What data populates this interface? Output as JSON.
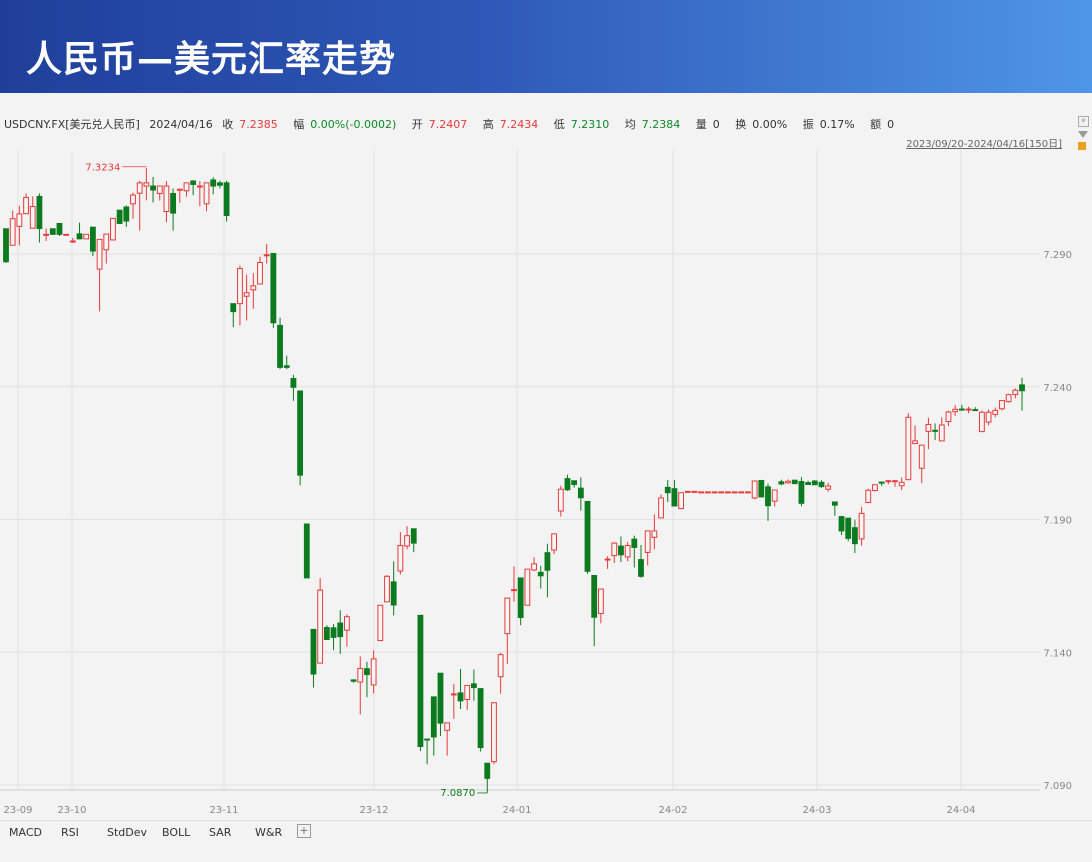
{
  "header": {
    "title": "人民币—美元汇率走势"
  },
  "quote": {
    "symbol": "USDCNY.FX[美元兑人民币]",
    "date": "2024/04/16",
    "close_label": "收",
    "close": "7.2385",
    "change_label": "幅",
    "change": "0.00%(-0.0002)",
    "open_label": "开",
    "open": "7.2407",
    "high_label": "高",
    "high": "7.2434",
    "low_label": "低",
    "low": "7.2310",
    "avg_label": "均",
    "avg": "7.2384",
    "volume_label": "量",
    "volume": "0",
    "turnover_label": "换",
    "turnover": "0.00%",
    "amplitude_label": "振",
    "amplitude": "0.17%",
    "amount_label": "额",
    "amount": "0"
  },
  "range_label": "2023/09/20-2024/04/16[150日]",
  "indicators": [
    "MACD",
    "RSI",
    "StdDev",
    "BOLL",
    "SAR",
    "W&R"
  ],
  "colors": {
    "up": "#e83a3a",
    "down": "#0c7a1e",
    "grid": "#e2e2e2",
    "axis_text": "#888888"
  },
  "chart_data": {
    "type": "candlestick",
    "ylim": [
      7.085,
      7.335
    ],
    "yticks": [
      "7.290",
      "7.240",
      "7.190",
      "7.140",
      "7.090"
    ],
    "xticks": [
      "23-09",
      "23-10",
      "23-11",
      "23-12",
      "24-01",
      "24-02",
      "24-03",
      "24-04"
    ],
    "max_label": "7.3234",
    "min_label": "7.0870",
    "ohlc": [
      [
        7.2995,
        7.2995,
        7.2866,
        7.2871
      ],
      [
        7.2933,
        7.3064,
        7.2933,
        7.3033
      ],
      [
        7.3004,
        7.3081,
        7.2933,
        7.3051
      ],
      [
        7.3052,
        7.3128,
        7.3052,
        7.3113
      ],
      [
        7.2997,
        7.3117,
        7.2997,
        7.3079
      ],
      [
        7.3117,
        7.3128,
        7.2943,
        7.2996
      ],
      [
        7.2974,
        7.2996,
        7.2949,
        7.2974
      ],
      [
        7.2995,
        7.2995,
        7.2974,
        7.2974
      ],
      [
        7.3015,
        7.3015,
        7.2968,
        7.2974
      ],
      [
        7.2974,
        7.2974,
        7.2974,
        7.2974
      ],
      [
        7.2949,
        7.2961,
        7.2942,
        7.2949
      ],
      [
        7.2976,
        7.3018,
        7.2957,
        7.2957
      ],
      [
        7.2957,
        7.2974,
        7.2957,
        7.2974
      ],
      [
        7.3001,
        7.3001,
        7.2892,
        7.2911
      ],
      [
        7.2843,
        7.2935,
        7.2684,
        7.2955
      ],
      [
        7.2916,
        7.2975,
        7.2864,
        7.2975
      ],
      [
        7.2953,
        7.3034,
        7.2953,
        7.3034
      ],
      [
        7.3065,
        7.3065,
        7.3015,
        7.3015
      ],
      [
        7.3077,
        7.3083,
        7.3002,
        7.3024
      ],
      [
        7.3089,
        7.3131,
        7.3033,
        7.3122
      ],
      [
        7.3129,
        7.3176,
        7.2988,
        7.3168
      ],
      [
        7.3156,
        7.3225,
        7.3102,
        7.3168
      ],
      [
        7.3156,
        7.319,
        7.3094,
        7.3141
      ],
      [
        7.3128,
        7.3156,
        7.3101,
        7.3156
      ],
      [
        7.306,
        7.3175,
        7.302,
        7.3156
      ],
      [
        7.3128,
        7.3147,
        7.2988,
        7.3054
      ],
      [
        7.3143,
        7.3146,
        7.3093,
        7.3144
      ],
      [
        7.3138,
        7.3168,
        7.3116,
        7.3168
      ],
      [
        7.3175,
        7.3178,
        7.3122,
        7.3162
      ],
      [
        7.3156,
        7.3175,
        7.308,
        7.3156
      ],
      [
        7.3089,
        7.3169,
        7.3061,
        7.3168
      ],
      [
        7.3179,
        7.3189,
        7.3125,
        7.3156
      ],
      [
        7.3168,
        7.3176,
        7.3147,
        7.3159
      ],
      [
        7.3168,
        7.3176,
        7.3022,
        7.3045
      ],
      [
        7.2713,
        7.2713,
        7.2624,
        7.2683
      ],
      [
        7.2713,
        7.2857,
        7.2631,
        7.2845
      ],
      [
        7.2741,
        7.2822,
        7.265,
        7.2754
      ],
      [
        7.2765,
        7.2828,
        7.2694,
        7.278
      ],
      [
        7.2787,
        7.289,
        7.2787,
        7.2868
      ],
      [
        7.2897,
        7.2938,
        7.2864,
        7.2897
      ],
      [
        7.2902,
        7.2901,
        7.2622,
        7.2641
      ],
      [
        7.2631,
        7.266,
        7.2466,
        7.2473
      ],
      [
        7.2479,
        7.2517,
        7.2466,
        7.2473
      ],
      [
        7.2431,
        7.2445,
        7.2347,
        7.2398
      ],
      [
        7.2384,
        7.2384,
        7.2029,
        7.2067
      ],
      [
        7.1883,
        7.1883,
        7.168,
        7.168
      ],
      [
        7.1486,
        7.1486,
        7.1267,
        7.1318
      ],
      [
        7.1359,
        7.168,
        7.1359,
        7.1634
      ],
      [
        7.1493,
        7.1502,
        7.1449,
        7.1448
      ],
      [
        7.1492,
        7.1506,
        7.1408,
        7.1456
      ],
      [
        7.151,
        7.1558,
        7.1394,
        7.1459
      ],
      [
        7.1483,
        7.1543,
        7.1421,
        7.1534
      ],
      [
        7.1296,
        7.1296,
        7.1285,
        7.1291
      ],
      [
        7.1288,
        7.1385,
        7.1166,
        7.1339
      ],
      [
        7.1338,
        7.1364,
        7.1231,
        7.1316
      ],
      [
        7.1277,
        7.1407,
        7.1245,
        7.1375
      ],
      [
        7.1444,
        7.1575,
        7.1444,
        7.1577
      ],
      [
        7.159,
        7.1691,
        7.159,
        7.1686
      ],
      [
        7.1665,
        7.1742,
        7.1539,
        7.1578
      ],
      [
        7.1706,
        7.1853,
        7.1693,
        7.1802
      ],
      [
        7.18,
        7.1875,
        7.1788,
        7.1839
      ],
      [
        7.1865,
        7.1862,
        7.1777,
        7.1811
      ],
      [
        7.1539,
        7.1539,
        7.1028,
        7.1045
      ],
      [
        7.1073,
        7.1073,
        7.0978,
        7.107
      ],
      [
        7.1232,
        7.1232,
        7.1011,
        7.1081
      ],
      [
        7.1321,
        7.1321,
        7.1084,
        7.1133
      ],
      [
        7.1106,
        7.1106,
        7.1011,
        7.1134
      ],
      [
        7.1243,
        7.1281,
        7.1149,
        7.1243
      ],
      [
        7.1247,
        7.1337,
        7.1186,
        7.1217
      ],
      [
        7.1222,
        7.1275,
        7.1183,
        7.1275
      ],
      [
        7.1281,
        7.1335,
        7.1218,
        7.1267
      ],
      [
        7.1263,
        7.1263,
        7.1026,
        7.1041
      ],
      [
        7.0982,
        7.0982,
        7.087,
        7.0925
      ],
      [
        7.0988,
        7.121,
        7.0978,
        7.121
      ],
      [
        7.1308,
        7.1398,
        7.1244,
        7.1391
      ],
      [
        7.147,
        7.1604,
        7.1356,
        7.1604
      ],
      [
        7.1636,
        7.1723,
        7.1591,
        7.1636
      ],
      [
        7.168,
        7.168,
        7.1502,
        7.1531
      ],
      [
        7.1577,
        7.1713,
        7.1577,
        7.1713
      ],
      [
        7.171,
        7.1758,
        7.1705,
        7.1733
      ],
      [
        7.1701,
        7.1726,
        7.164,
        7.1688
      ],
      [
        7.1775,
        7.1809,
        7.1607,
        7.1709
      ],
      [
        7.1785,
        7.1846,
        7.1769,
        7.1846
      ],
      [
        7.1932,
        7.2027,
        7.1911,
        7.2014
      ],
      [
        7.2054,
        7.2069,
        7.2008,
        7.2012
      ],
      [
        7.2046,
        7.2046,
        7.202,
        7.2032
      ],
      [
        7.2018,
        7.2059,
        7.1933,
        7.1982
      ],
      [
        7.1968,
        7.1968,
        7.1695,
        7.1705
      ],
      [
        7.1689,
        7.1689,
        7.1423,
        7.1532
      ],
      [
        7.1546,
        7.1638,
        7.1509,
        7.1638
      ],
      [
        7.1751,
        7.1762,
        7.1714,
        7.1751
      ],
      [
        7.1764,
        7.1815,
        7.1736,
        7.1811
      ],
      [
        7.18,
        7.1836,
        7.174,
        7.1767
      ],
      [
        7.1759,
        7.1815,
        7.1743,
        7.1802
      ],
      [
        7.1826,
        7.1839,
        7.1719,
        7.1795
      ],
      [
        7.1749,
        7.1804,
        7.168,
        7.1686
      ],
      [
        7.1776,
        7.1858,
        7.1727,
        7.1857
      ],
      [
        7.1833,
        7.1919,
        7.1788,
        7.1857
      ],
      [
        7.1906,
        7.1995,
        7.1906,
        7.1981
      ],
      [
        7.2021,
        7.2049,
        7.1966,
        7.2001
      ],
      [
        7.2016,
        7.2049,
        7.1951,
        7.1951
      ],
      [
        7.1941,
        7.2001,
        7.1941,
        7.2001
      ],
      [
        7.2002,
        7.2006,
        7.2002,
        7.2006
      ],
      [
        7.2006,
        7.2006,
        7.2006,
        7.2006
      ],
      [
        7.2002,
        7.2004,
        7.2002,
        7.2004
      ],
      [
        7.2004,
        7.2004,
        7.2004,
        7.2004
      ],
      [
        7.2004,
        7.2004,
        7.2004,
        7.2004
      ],
      [
        7.2004,
        7.2004,
        7.2004,
        7.2004
      ],
      [
        7.2004,
        7.2004,
        7.2004,
        7.2004
      ],
      [
        7.2004,
        7.2004,
        7.2004,
        7.2004
      ],
      [
        7.2004,
        7.2004,
        7.2004,
        7.2004
      ],
      [
        7.2004,
        7.2004,
        7.2004,
        7.2004
      ],
      [
        7.1981,
        7.2047,
        7.1976,
        7.2045
      ],
      [
        7.2047,
        7.2047,
        7.1985,
        7.1985
      ],
      [
        7.2023,
        7.2035,
        7.1895,
        7.1952
      ],
      [
        7.1969,
        7.2011,
        7.1949,
        7.2011
      ],
      [
        7.2042,
        7.205,
        7.2029,
        7.2034
      ],
      [
        7.2038,
        7.2051,
        7.2034,
        7.2044
      ],
      [
        7.2048,
        7.2048,
        7.2035,
        7.2035
      ],
      [
        7.2043,
        7.206,
        7.195,
        7.1961
      ],
      [
        7.2039,
        7.2046,
        7.203,
        7.2032
      ],
      [
        7.2045,
        7.2048,
        7.203,
        7.2031
      ],
      [
        7.204,
        7.2048,
        7.2019,
        7.2024
      ],
      [
        7.2014,
        7.2038,
        7.2005,
        7.2026
      ],
      [
        7.1966,
        7.1966,
        7.1914,
        7.1954
      ],
      [
        7.1911,
        7.1914,
        7.1841,
        7.1857
      ],
      [
        7.1905,
        7.1905,
        7.1818,
        7.1829
      ],
      [
        7.1869,
        7.1899,
        7.1774,
        7.1809
      ],
      [
        7.1827,
        7.1947,
        7.1802,
        7.1923
      ],
      [
        7.1964,
        7.2016,
        7.1961,
        7.201
      ],
      [
        7.2009,
        7.2031,
        7.2006,
        7.2031
      ],
      [
        7.2041,
        7.2041,
        7.2027,
        7.2037
      ],
      [
        7.2046,
        7.2049,
        7.2033,
        7.2046
      ],
      [
        7.2046,
        7.2049,
        7.2023,
        7.2046
      ],
      [
        7.2027,
        7.2058,
        7.2011,
        7.204
      ],
      [
        7.205,
        7.23,
        7.205,
        7.2285
      ],
      [
        7.2186,
        7.2254,
        7.2184,
        7.2196
      ],
      [
        7.2093,
        7.218,
        7.2037,
        7.218
      ],
      [
        7.2232,
        7.2283,
        7.2165,
        7.2258
      ],
      [
        7.2236,
        7.2262,
        7.2199,
        7.2232
      ],
      [
        7.2196,
        7.2285,
        7.2196,
        7.2256
      ],
      [
        7.2269,
        7.231,
        7.2252,
        7.2305
      ],
      [
        7.2306,
        7.2331,
        7.229,
        7.2315
      ],
      [
        7.2316,
        7.2332,
        7.231,
        7.2314
      ],
      [
        7.2316,
        7.2325,
        7.23,
        7.2316
      ],
      [
        7.2314,
        7.2323,
        7.231,
        7.2312
      ],
      [
        7.2231,
        7.231,
        7.2231,
        7.2304
      ],
      [
        7.2267,
        7.2314,
        7.2255,
        7.2304
      ],
      [
        7.2296,
        7.2322,
        7.2285,
        7.2311
      ],
      [
        7.2317,
        7.2348,
        7.2311,
        7.2348
      ],
      [
        7.2344,
        7.2374,
        7.234,
        7.237
      ],
      [
        7.2371,
        7.2394,
        7.2356,
        7.2387
      ],
      [
        7.2407,
        7.2434,
        7.231,
        7.2385
      ]
    ]
  }
}
